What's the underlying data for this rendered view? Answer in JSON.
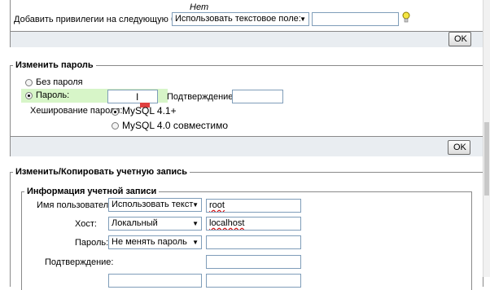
{
  "privileges": {
    "none_label": "Нет",
    "add_to_db_label": "Добавить привилегии на следующую базу:",
    "db_select_value": "Использовать текстовое поле:",
    "db_input_value": "",
    "ok_label": "OK"
  },
  "change_password": {
    "legend": "Изменить пароль",
    "no_password_label": "Без пароля",
    "password_label": "Пароль:",
    "password_value": "",
    "confirm_label": "Подтверждение:",
    "confirm_value": "",
    "hashing_label": "Хеширование пароля:",
    "hash_option1": "MySQL 4.1+",
    "hash_option2": "MySQL 4.0 совместимо",
    "ok_label": "OK"
  },
  "copy_account": {
    "legend": "Изменить/Копировать учетную запись",
    "info_legend": "Информация учетной записи",
    "username_label": "Имя пользователя:",
    "username_select": "Использовать текст",
    "username_value": "root",
    "host_label": "Хост:",
    "host_select": "Локальный",
    "host_value": "localhost",
    "password_label": "Пароль:",
    "password_select": "Не менять пароль",
    "password_value": "",
    "confirm_label": "Подтверждение:",
    "confirm_value": ""
  }
}
